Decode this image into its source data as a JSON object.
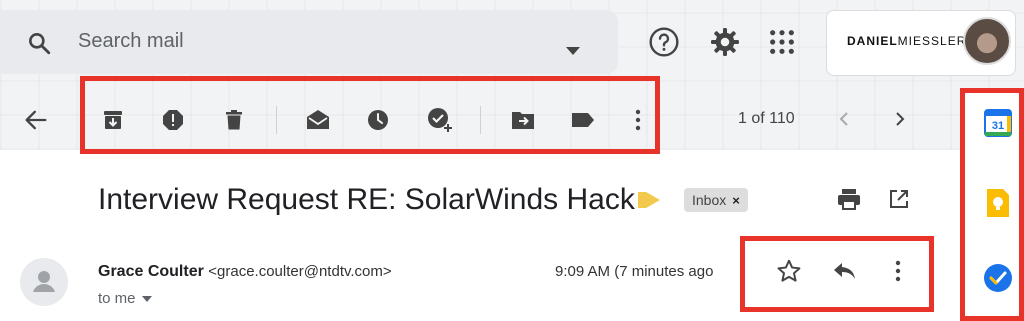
{
  "search": {
    "placeholder": "Search mail"
  },
  "profile": {
    "brand_bold": "DANIEL",
    "brand_light": "MIESSLER"
  },
  "pager": {
    "text": "1 of 110"
  },
  "message": {
    "subject": "Interview Request RE: SolarWinds Hack",
    "label": "Inbox",
    "label_close": "×",
    "sender_name": "Grace Coulter",
    "sender_email": "<grace.coulter@ntdtv.com>",
    "time": "9:09 AM (7 minutes ago",
    "to": "to me"
  },
  "sidebar": {
    "calendar_day": "31"
  },
  "colors": {
    "highlight_red": "#e8332a",
    "icon_gray": "#5f6368",
    "calendar_blue": "#1a73e8",
    "keep_yellow": "#fbbc04",
    "tasks_blue": "#1a73e8"
  },
  "icons": {
    "toolbar": [
      "archive-icon",
      "report-spam-icon",
      "delete-icon",
      "mark-unread-icon",
      "snooze-icon",
      "add-task-icon",
      "move-to-icon",
      "label-icon",
      "more-vert-icon"
    ],
    "header": [
      "search-icon",
      "help-icon",
      "settings-icon",
      "apps-icon"
    ],
    "sidebar": [
      "calendar-icon",
      "keep-icon",
      "tasks-icon"
    ]
  }
}
